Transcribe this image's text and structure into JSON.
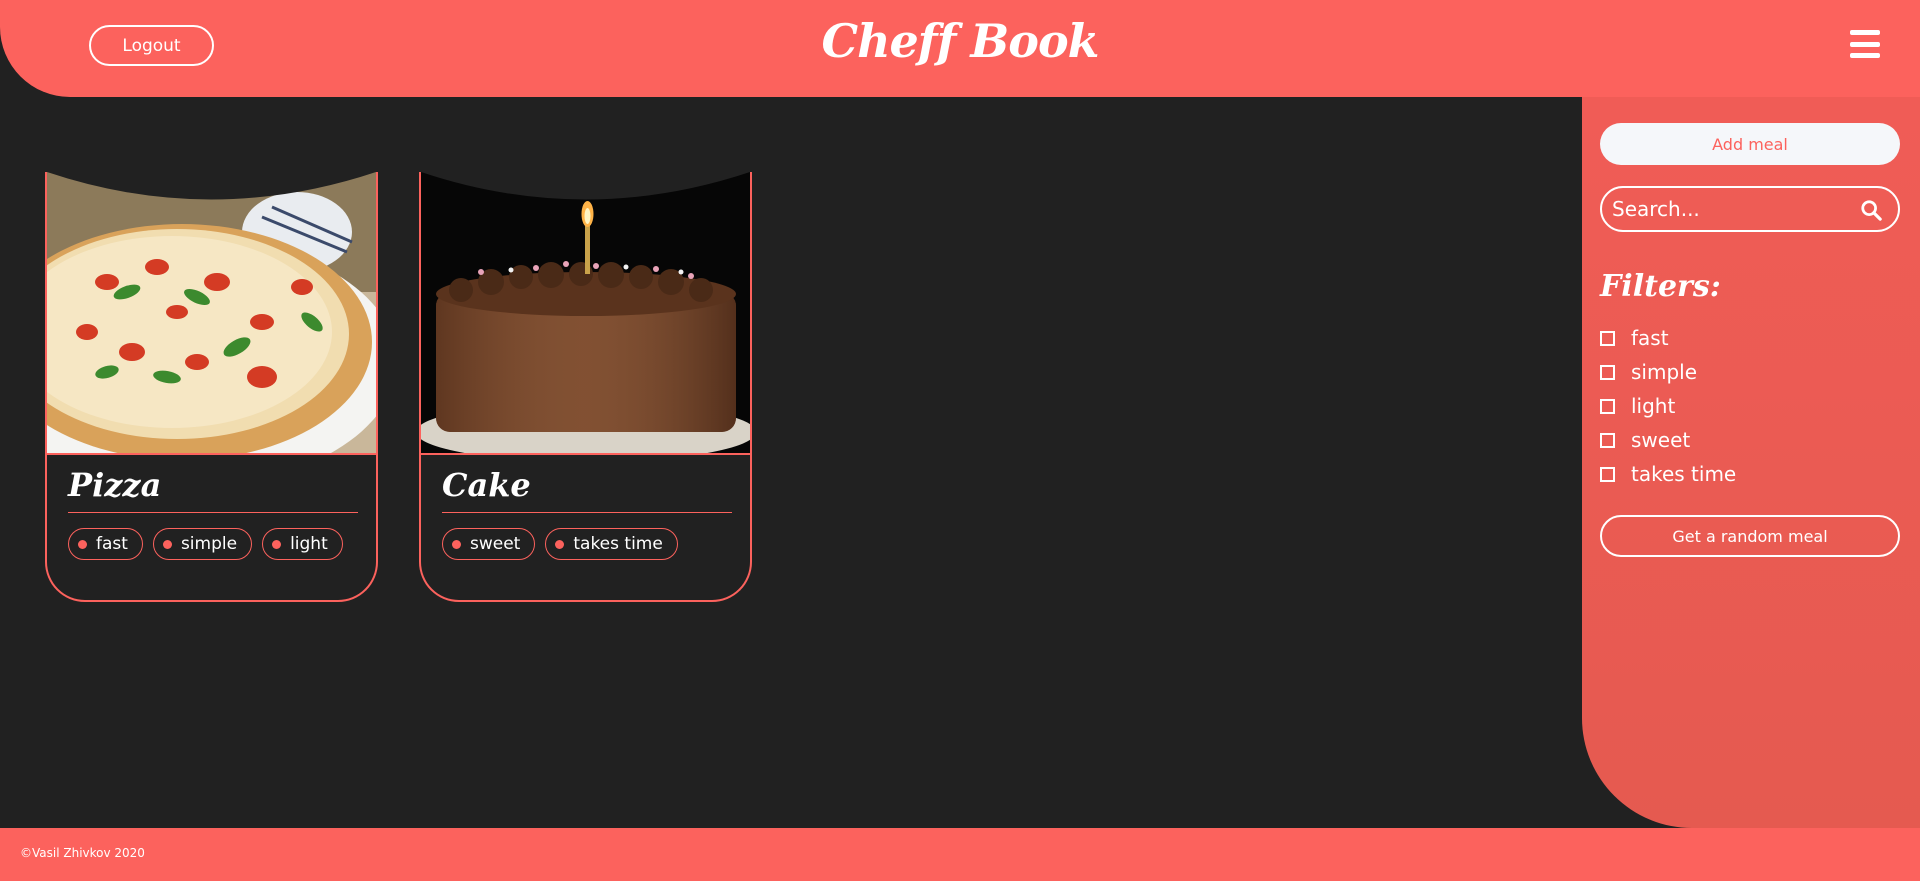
{
  "header": {
    "brand": "Cheff Book",
    "logout_label": "Logout",
    "menu_icon": "hamburger-menu-icon"
  },
  "sidebar": {
    "add_meal_label": "Add meal",
    "search_placeholder": "Search...",
    "search_icon": "search-icon",
    "filters_title": "Filters:",
    "filters": [
      {
        "label": "fast",
        "checked": false
      },
      {
        "label": "simple",
        "checked": false
      },
      {
        "label": "light",
        "checked": false
      },
      {
        "label": "sweet",
        "checked": false
      },
      {
        "label": "takes time",
        "checked": false
      }
    ],
    "random_label": "Get a random meal"
  },
  "meals": [
    {
      "title": "Pizza",
      "image": "pizza-photo",
      "tags": [
        "fast",
        "simple",
        "light"
      ]
    },
    {
      "title": "Cake",
      "image": "chocolate-cake-photo",
      "tags": [
        "sweet",
        "takes time"
      ]
    }
  ],
  "footer": {
    "copyright": "©Vasil Zhivkov 2020"
  },
  "colors": {
    "accent": "#fc625d",
    "background": "#212121",
    "sidebar": "#f05c56",
    "text": "#ffffff"
  }
}
